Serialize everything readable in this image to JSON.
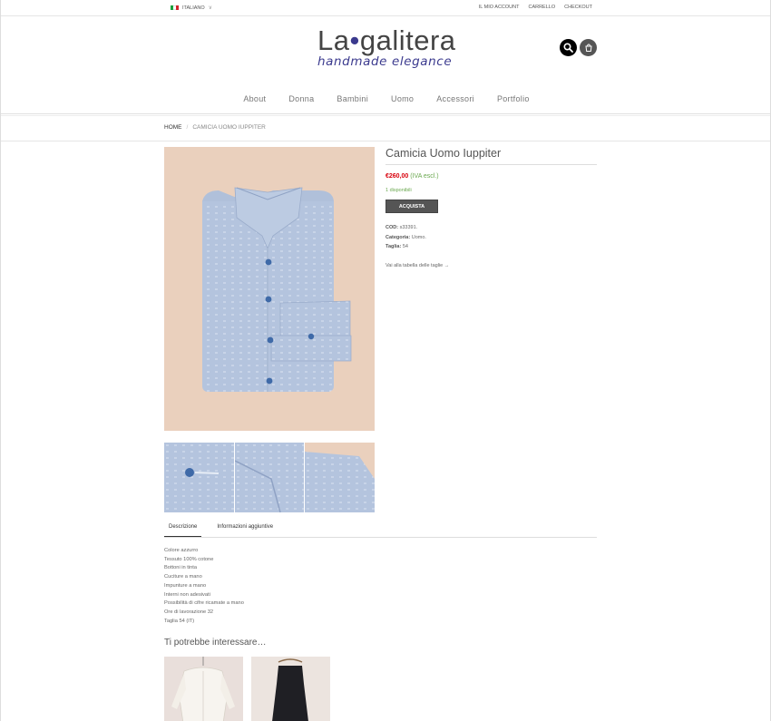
{
  "topbar": {
    "language": "ITALIANO",
    "links": [
      "IL MIO ACCOUNT",
      "CARRELLO",
      "CHECKOUT"
    ]
  },
  "logo": {
    "name_part1": "La",
    "dot": "•",
    "name_part2": "galitera",
    "tagline": "handmade elegance"
  },
  "icons": {
    "search": "search-icon",
    "cart": "cart-icon"
  },
  "nav": [
    "About",
    "Donna",
    "Bambini",
    "Uomo",
    "Accessori",
    "Portfolio"
  ],
  "breadcrumb": {
    "home": "HOME",
    "separator": "/",
    "current": "CAMICIA UOMO IUPPITER"
  },
  "product": {
    "title": "Camicia Uomo Iuppiter",
    "price": "€260,00",
    "price_note": "(IVA escl.)",
    "stock": "1 disponibili",
    "buy_label": "ACQUISTA",
    "cod_label": "COD:",
    "cod_value": "s33391.",
    "category_label": "Categoria:",
    "category_value": "Uomo.",
    "size_label": "Taglia:",
    "size_value": "54",
    "size_guide": "Vai alla tabella delle taglie →"
  },
  "tabs": [
    "Descrizione",
    "Informazioni aggiuntive"
  ],
  "description": [
    "Colore azzurro",
    "Tessuto 100% cotone",
    "Bottoni in tinta",
    "Cuciture a mano",
    "Impunture a mano",
    "Interni non adesivati",
    "Possibilità di cifre ricamate a mano",
    "Ore di lavorazione 32",
    "Taglia 54 (IT)"
  ],
  "related_title": "Ti potrebbe interessare…",
  "colors": {
    "accent": "#3b3a8e",
    "price": "#d8000c",
    "stock": "#6aa84f",
    "button": "#555555"
  }
}
